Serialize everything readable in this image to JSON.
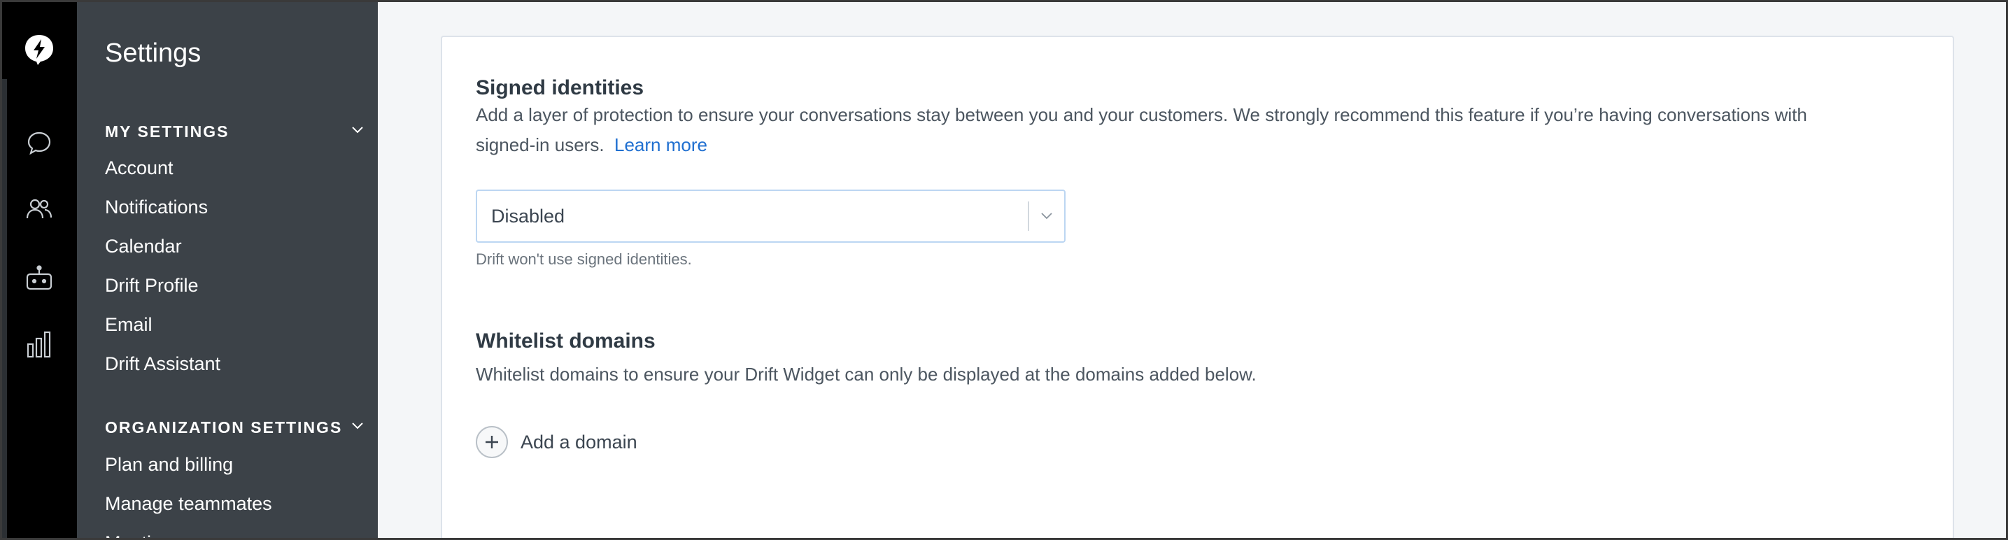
{
  "rail": {
    "items": [
      {
        "icon": "drift-logo-icon"
      },
      {
        "icon": "chat-bubble-icon"
      },
      {
        "icon": "people-icon"
      },
      {
        "icon": "bot-icon"
      },
      {
        "icon": "bar-chart-icon"
      }
    ]
  },
  "sidebar": {
    "title": "Settings",
    "my_settings": {
      "label": "MY SETTINGS",
      "items": [
        "Account",
        "Notifications",
        "Calendar",
        "Drift Profile",
        "Email",
        "Drift Assistant"
      ]
    },
    "org_settings": {
      "label": "ORGANIZATION SETTINGS",
      "items": [
        "Plan and billing",
        "Manage teammates",
        "Meetings"
      ]
    }
  },
  "signed_identities": {
    "title": "Signed identities",
    "description_line1": "Add a layer of protection to ensure your conversations stay between you and your customers. We strongly recommend this feature if you’re having conversations with",
    "description_line2": "signed-in users.",
    "learn_more": "Learn more",
    "select_value": "Disabled",
    "hint": "Drift won't use signed identities."
  },
  "whitelist": {
    "title": "Whitelist domains",
    "description": "Whitelist domains to ensure your Drift Widget can only be displayed at the domains added below.",
    "add_label": "Add a domain"
  },
  "colors": {
    "rail_bg": "#000000",
    "sidebar_bg": "#3c4248",
    "link": "#1f6fd0",
    "select_border": "#bcd6f2"
  }
}
